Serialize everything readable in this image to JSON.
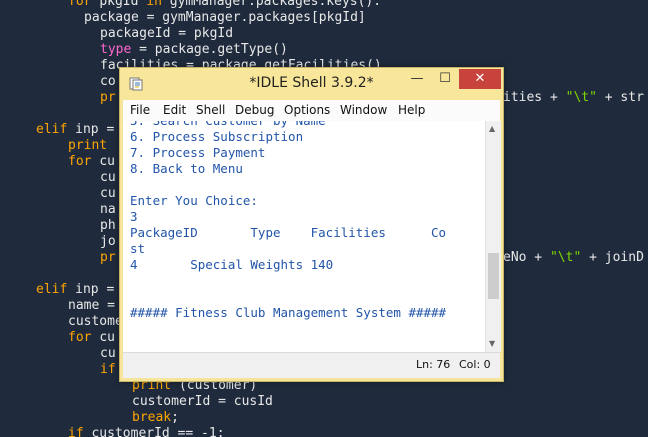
{
  "editor": {
    "lines": [
      [
        [
          "kw",
          "for "
        ],
        [
          "pl",
          "pkgId "
        ],
        [
          "kw",
          "in "
        ],
        [
          "pl",
          "gymManager.packages.keys():"
        ]
      ],
      [
        [
          "pl",
          "package = gymManager.packages[pkgId]"
        ]
      ],
      [
        [
          "pl",
          "packageId = pkgId"
        ]
      ],
      [
        [
          "mg",
          "type"
        ],
        [
          "pl",
          " = package.getType()"
        ]
      ],
      [
        [
          "pl",
          "facilities = package.getFacilities()"
        ]
      ],
      [
        [
          "pl",
          "co"
        ]
      ],
      [
        [
          "kw",
          "pr"
        ]
      ],
      [
        [
          "kw",
          "elif "
        ],
        [
          "pl",
          "inp ="
        ]
      ],
      [
        [
          "kw",
          "print"
        ]
      ],
      [
        [
          "kw",
          "for "
        ],
        [
          "pl",
          "cu"
        ]
      ],
      [
        [
          "pl",
          "cu"
        ]
      ],
      [
        [
          "pl",
          "cu"
        ]
      ],
      [
        [
          "pl",
          "na"
        ]
      ],
      [
        [
          "pl",
          "ph"
        ]
      ],
      [
        [
          "pl",
          "jo"
        ]
      ],
      [
        [
          "kw",
          "pr"
        ]
      ],
      [
        [
          "kw",
          "elif "
        ],
        [
          "pl",
          "inp ="
        ]
      ],
      [
        [
          "pl",
          "name ="
        ]
      ],
      [
        [
          "pl",
          "custome"
        ]
      ],
      [
        [
          "kw",
          "for "
        ],
        [
          "pl",
          "cu"
        ]
      ],
      [
        [
          "pl",
          "cu"
        ]
      ],
      [
        [
          "kw",
          "if"
        ]
      ],
      [
        [
          "fn",
          "print"
        ],
        [
          "pl",
          " (customer)"
        ]
      ],
      [
        [
          "pl",
          "customerId = cusId"
        ]
      ],
      [
        [
          "kw",
          "break"
        ],
        [
          "pl",
          ";"
        ]
      ],
      [
        [
          "kw",
          "if "
        ],
        [
          "pl",
          "customerId == -1:"
        ]
      ]
    ],
    "right_line_1": [
      [
        "pl",
        "ities + "
      ],
      [
        "st",
        "\"\\t\""
      ],
      [
        "pl",
        " + str"
      ]
    ],
    "right_line_2": [
      [
        "pl",
        "eNo + "
      ],
      [
        "st",
        "\"\\t\""
      ],
      [
        "pl",
        " + joinD"
      ]
    ]
  },
  "window": {
    "title": "*IDLE Shell 3.9.2*",
    "min_label": "—",
    "max_label": "☐",
    "close_label": "✕"
  },
  "menus": [
    "File",
    "Edit",
    "Shell",
    "Debug",
    "Options",
    "Window",
    "Help"
  ],
  "shell_lines": [
    "5. Search Customer by Name",
    "6. Process Subscription",
    "7. Process Payment",
    "8. Back to Menu",
    "",
    "Enter You Choice:",
    "3",
    "PackageID\tType\tFacilities\tCo",
    "st",
    "4\tSpecial Weights 140",
    "",
    "",
    "##### Fitness Club Management System #####"
  ],
  "status": {
    "ln": "Ln: 76",
    "col": "Col: 0"
  },
  "colors": {
    "editor_bg": "#1f2b3d",
    "keyword": "#ffa500",
    "string": "#7fd500",
    "title_bg": "#f8e69a",
    "close": "#c7433b",
    "shell_text": "#2255aa"
  }
}
